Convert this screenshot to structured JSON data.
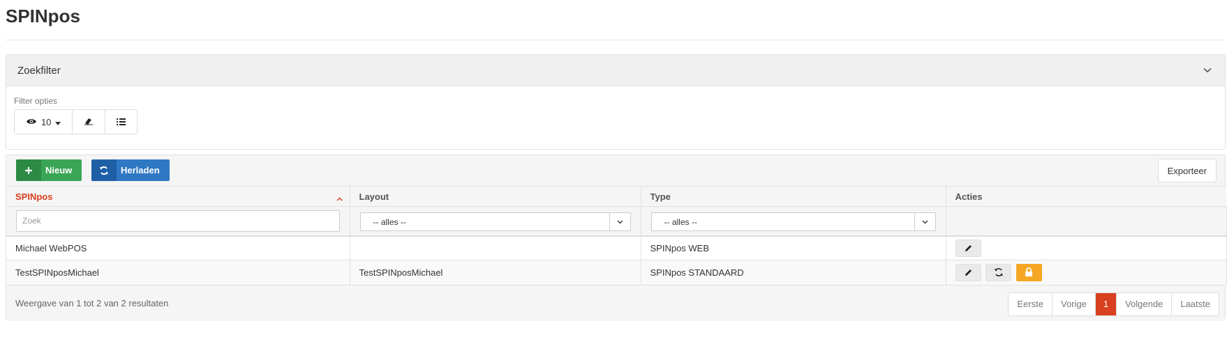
{
  "page": {
    "title": "SPINpos"
  },
  "filter_panel": {
    "title": "Zoekfilter",
    "options_label": "Filter opties",
    "page_size": "10"
  },
  "toolbar": {
    "new_label": "Nieuw",
    "reload_label": "Herladen",
    "export_label": "Exporteer"
  },
  "table": {
    "columns": [
      "SPINpos",
      "Layout",
      "Type",
      "Acties"
    ],
    "search_placeholder": "Zoek",
    "layout_filter": "-- alles --",
    "type_filter": "-- alles --",
    "rows": [
      {
        "spinpos": "Michael WebPOS",
        "layout": "",
        "type": "SPINpos WEB",
        "actions": [
          "edit"
        ]
      },
      {
        "spinpos": "TestSPINposMichael",
        "layout": "TestSPINposMichael",
        "type": "SPINpos STANDAARD",
        "actions": [
          "edit",
          "reload",
          "lock"
        ]
      }
    ]
  },
  "footer": {
    "summary": "Weergave van 1 tot 2 van 2 resultaten",
    "pager": [
      "Eerste",
      "Vorige",
      "1",
      "Volgende",
      "Laatste"
    ],
    "active_page": "1"
  },
  "colors": {
    "accent": "#d9401f",
    "green": "#3aa655",
    "blue": "#2f78c4",
    "orange": "#f5a623"
  }
}
